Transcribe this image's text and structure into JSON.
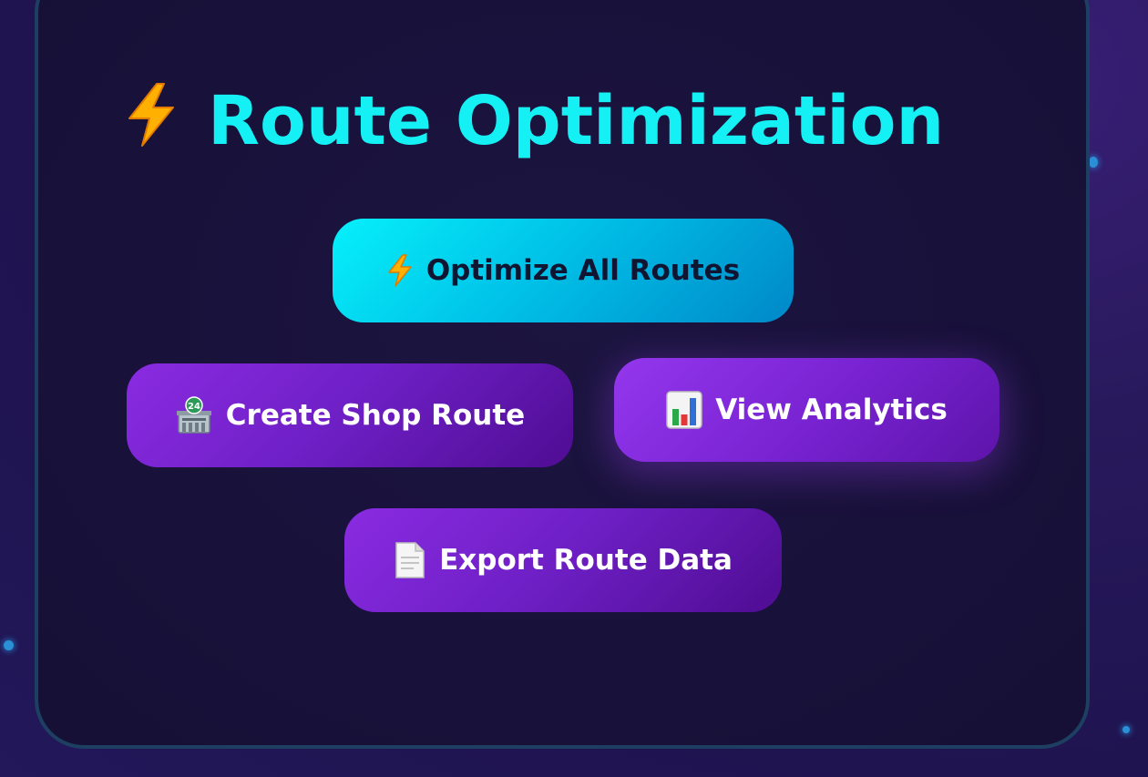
{
  "page": {
    "title": "Route Optimization",
    "title_icon": "lightning-bolt-icon"
  },
  "actions": {
    "optimize": {
      "label": "Optimize All Routes",
      "icon": "lightning-bolt-icon"
    },
    "create_shop": {
      "label": "Create Shop Route",
      "icon": "convenience-store-icon"
    },
    "analytics": {
      "label": "View Analytics",
      "icon": "bar-chart-icon"
    },
    "export": {
      "label": "Export Route Data",
      "icon": "document-icon"
    }
  },
  "colors": {
    "title": "#14f0f4",
    "primary_button": "#06f0fa",
    "secondary_button": "#7a22d6",
    "panel_border": "#1d3f62",
    "background": "#24185c"
  }
}
